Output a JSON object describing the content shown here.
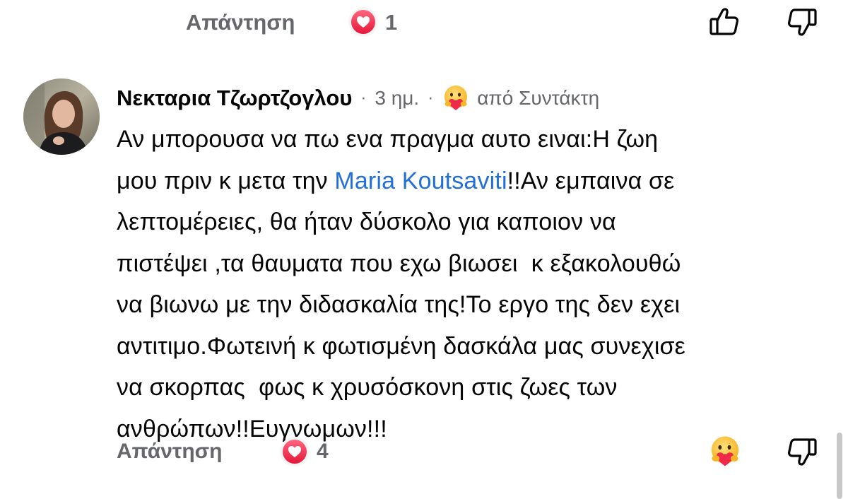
{
  "previous_comment": {
    "actions": {
      "reply_label": "Απάντηση",
      "reaction_count": "1",
      "reaction_icon": "heart-icon",
      "like_icon": "thumbs-up-icon",
      "dislike_icon": "thumbs-down-icon"
    }
  },
  "comment": {
    "author": "Νεκταρια Τζωρτζογλου",
    "time": "3 ημ.",
    "separator": "·",
    "badge_icon": "hug-emoji-icon",
    "from_author_label": "από Συντάκτη",
    "body_lines": [
      {
        "before": "Αν μπορουσα να πω ενα πραγμα αυτο ειναι:Η ζωη"
      },
      {
        "before": "μου πριν κ μετα την ",
        "mention": "Maria Koutsaviti",
        "after": "!!Αν εμπαινα σε"
      },
      {
        "before": "λεπτομέρειες, θα ήταν δύσκολο για καποιον να"
      },
      {
        "before": "πιστέψει ,τα θαυματα που εχω βιωσει  κ εξακολουθώ"
      },
      {
        "before": "να βιωνω με την διδασκαλία της!Το εργο της δεν εχει"
      },
      {
        "before": "αντιτιμο.Φωτεινή κ φωτισμένη δασκάλα μας συνεχισε"
      },
      {
        "before": "να σκορπας  φως κ χρυσόσκονη στις ζωες των"
      },
      {
        "before": "ανθρώπων!!Ευγνωμων!!!"
      }
    ],
    "actions": {
      "reply_label": "Απάντηση",
      "reaction_count": "4",
      "reaction_icon": "heart-icon",
      "care_icon": "hug-emoji-icon",
      "dislike_icon": "thumbs-down-icon"
    }
  },
  "colors": {
    "muted": "#65676b",
    "mention": "#216fdb",
    "heart": "#f02849",
    "text": "#050505"
  }
}
